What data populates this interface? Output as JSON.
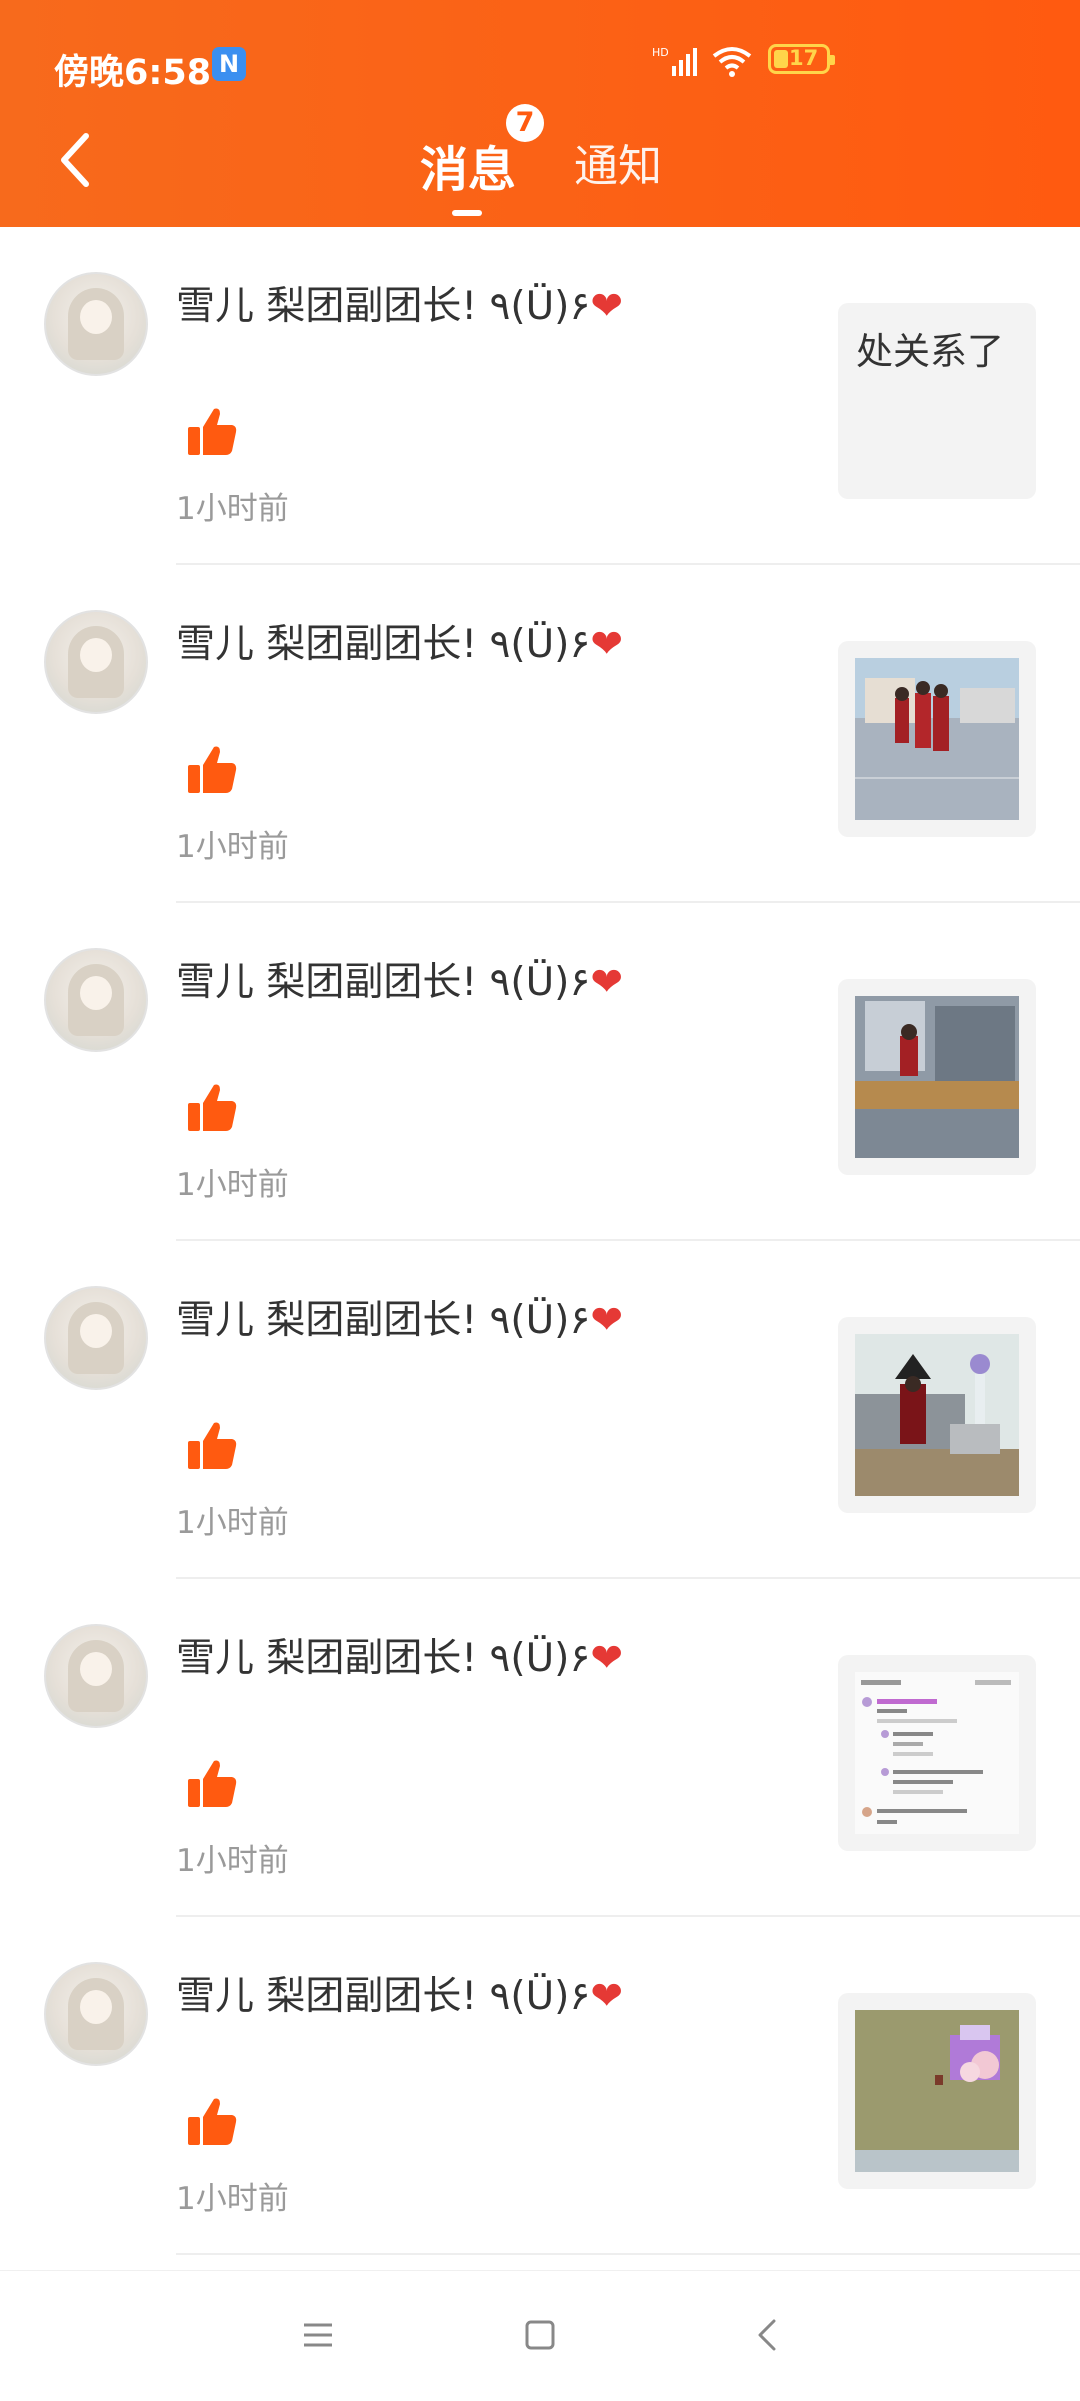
{
  "status_bar": {
    "time": "傍晚6:58",
    "app_icon": "N",
    "battery": "17",
    "network": "HD"
  },
  "header": {
    "tabs": [
      {
        "label": "消息",
        "active": true,
        "badge": "7"
      },
      {
        "label": "通知",
        "active": false
      }
    ]
  },
  "messages": [
    {
      "user": "雪儿  梨团副团长! ٩(Ü)۶",
      "heart": "❤",
      "time": "1小时前",
      "thumb_text": "处关系了"
    },
    {
      "user": "雪儿  梨团副团长! ٩(Ü)۶",
      "heart": "❤",
      "time": "1小时前",
      "thumb_text": ""
    },
    {
      "user": "雪儿  梨团副团长! ٩(Ü)۶",
      "heart": "❤",
      "time": "1小时前",
      "thumb_text": ""
    },
    {
      "user": "雪儿  梨团副团长! ٩(Ü)۶",
      "heart": "❤",
      "time": "1小时前",
      "thumb_text": ""
    },
    {
      "user": "雪儿  梨团副团长! ٩(Ü)۶",
      "heart": "❤",
      "time": "1小时前",
      "thumb_text": ""
    },
    {
      "user": "雪儿  梨团副团长! ٩(Ü)۶",
      "heart": "❤",
      "time": "1小时前",
      "thumb_text": ""
    }
  ],
  "colors": {
    "accent": "#ff5a10",
    "header_start": "#f76a1c",
    "heart": "#e53935",
    "time_text": "#9a9a9a"
  }
}
